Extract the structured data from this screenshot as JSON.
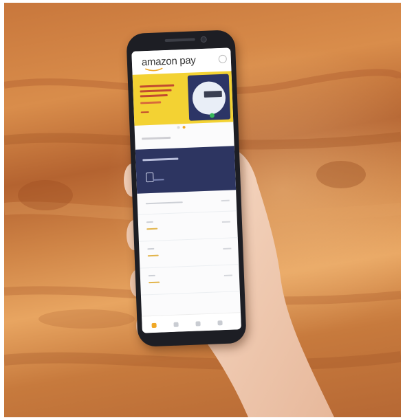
{
  "scene": {
    "description_free": true,
    "phone_app": {
      "logo_text": "amazon pay",
      "logo_smile_color": "#f0a826",
      "banner_color": "#f3d233",
      "card_color": "#2d3561",
      "active_tab_color": "#f0a826"
    },
    "icons": [
      "amazon-smile-icon",
      "profile-icon",
      "wallet-icon",
      "home-tab-icon",
      "tab-icon"
    ]
  }
}
